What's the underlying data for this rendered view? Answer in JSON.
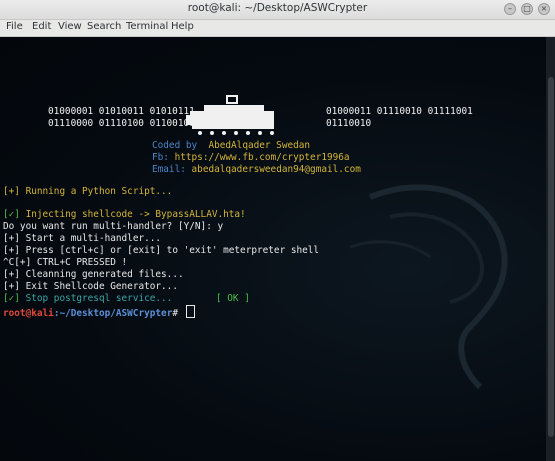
{
  "window": {
    "title": "root@kali: ~/Desktop/ASWCrypter",
    "buttons": [
      "minimize",
      "maximize",
      "close"
    ]
  },
  "menu": {
    "items": [
      "File",
      "Edit",
      "View",
      "Search",
      "Terminal",
      "Help"
    ]
  },
  "banner": {
    "bin_left_1": "01000001 01010011 01010111",
    "bin_left_2": "01110000 01110100 01100101",
    "bin_right_1": "01000011 01110010 01111001",
    "bin_right_2": "01110010"
  },
  "credits": {
    "coded_label": "Coded by",
    "coded_value": "AbedAlqader Swedan",
    "fb_label": "Fb:",
    "fb_value": "https://www.fb.com/crypter1996a",
    "email_label": "Email:",
    "email_value": "abedalqadersweedan94@gmail.com"
  },
  "output": {
    "running": "[+] Running a Python Script...",
    "inject_mark": "[✓]",
    "inject_text": " Injecting shellcode -> BypassALLAV.hta!",
    "prompt_q": "Do you want run multi-handler? [Y/N]: y",
    "start": "[+] Start a multi-handler...",
    "press": "[+] Press [ctrl+c] or [exit] to 'exit' meterpreter shell",
    "ctrlc": "^C[+] CTRL+C PRESSED !",
    "clean": "[+] Cleanning generated files...",
    "exit": "[+] Exit Shellcode Generator...",
    "stop_mark": "[✓]",
    "stop_text": " Stop postgresql service...",
    "ok": "[ OK ]"
  },
  "prompt": {
    "user": "root@kali",
    "path": ":~/Desktop/ASWCrypter",
    "symbol": "#"
  },
  "colors": {
    "background": "#04090f",
    "blue": "#4a86c8",
    "yellow": "#d4b53a",
    "green": "#4bbf4b",
    "red": "#e04a3a"
  }
}
